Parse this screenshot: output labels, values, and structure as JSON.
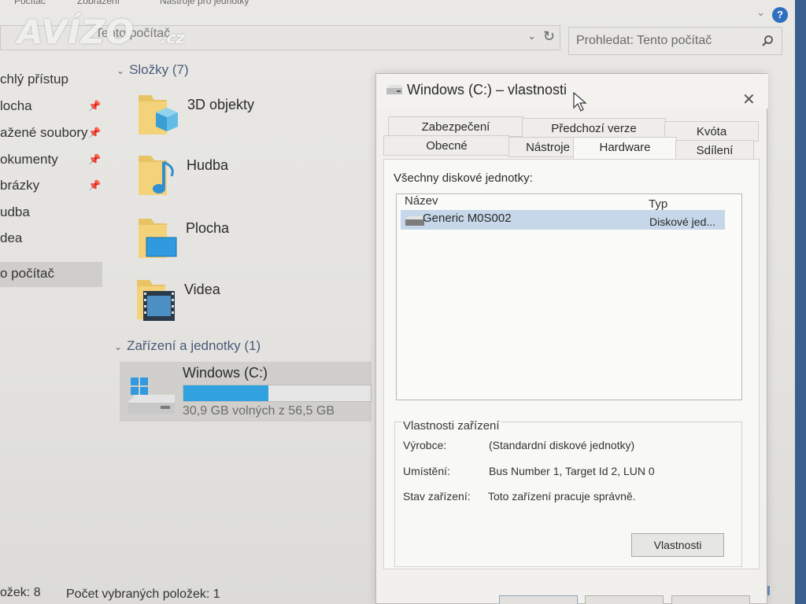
{
  "explorer": {
    "ribbon": {
      "tabs": [
        "Počítač",
        "Zobrazení",
        "Nástroje pro jednotky"
      ]
    },
    "address": {
      "path": "Tento počítač"
    },
    "search": {
      "placeholder": "Prohledat: Tento počítač"
    },
    "watermark": {
      "main": "AVÍZO",
      "suffix": ".cz"
    },
    "nav": [
      {
        "label": "chlý přístup",
        "pinned": false
      },
      {
        "label": "locha",
        "pinned": true
      },
      {
        "label": "ažené soubory",
        "pinned": true
      },
      {
        "label": "okumenty",
        "pinned": true
      },
      {
        "label": "brázky",
        "pinned": true
      },
      {
        "label": "udba",
        "pinned": false
      },
      {
        "label": "dea",
        "pinned": false
      },
      {
        "label": "o počítač",
        "pinned": false,
        "selected": true
      }
    ],
    "folders_header": "Složky (7)",
    "folders": [
      {
        "name": "3D objekty",
        "icon": "3d-objects-folder-icon"
      },
      {
        "name": "Hudba",
        "icon": "music-folder-icon"
      },
      {
        "name": "Plocha",
        "icon": "desktop-folder-icon"
      },
      {
        "name": "Videa",
        "icon": "videos-folder-icon"
      }
    ],
    "devices_header": "Zařízení a jednotky (1)",
    "drive": {
      "name": "Windows (C:)",
      "free_text": "30,9 GB volných z 56,5 GB",
      "used_fraction": 0.453,
      "bar_color": "#31a1e0"
    },
    "status": {
      "count": "ožek: 8",
      "selected": "Počet vybraných položek: 1"
    }
  },
  "dialog": {
    "title": "Windows (C:) – vlastnosti",
    "tabs_row1": [
      "Zabezpečení",
      "Předchozí verze",
      "Kvóta"
    ],
    "tabs_row2": [
      "Obecné",
      "Nástroje",
      "Hardware",
      "Sdílení"
    ],
    "active_tab": "Hardware",
    "disk_list_label": "Všechny diskové jednotky:",
    "columns": {
      "name": "Název",
      "type": "Typ"
    },
    "disks": [
      {
        "name": "Generic M0S002",
        "type": "Diskové jed..."
      }
    ],
    "device_props": {
      "title": "Vlastnosti zařízení",
      "manufacturer_label": "Výrobce:",
      "manufacturer_value": "(Standardní diskové jednotky)",
      "location_label": "Umístění:",
      "location_value": "Bus Number 1, Target Id 2, LUN 0",
      "status_label": "Stav zařízení:",
      "status_value": "Toto zařízení pracuje správně.",
      "button": "Vlastnosti"
    }
  },
  "colors": {
    "selection": "#c5d7e8",
    "drive_bar": "#31a1e0",
    "help_icon": "#2f6fc0",
    "group_header": "#4a5a78"
  }
}
